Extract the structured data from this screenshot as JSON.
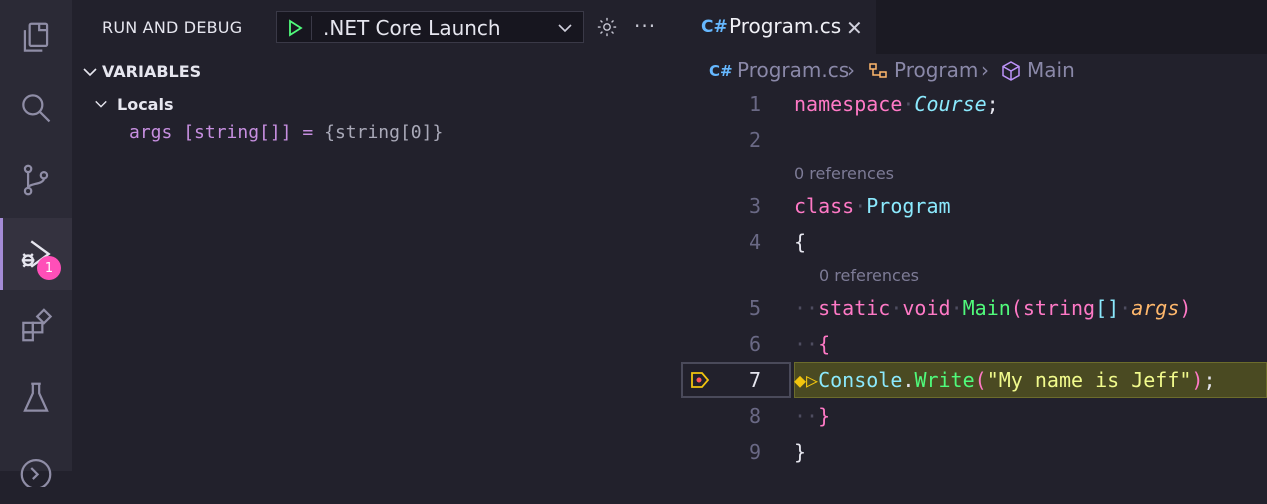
{
  "activity_bar": {
    "items": [
      {
        "name": "explorer"
      },
      {
        "name": "search"
      },
      {
        "name": "source-control"
      },
      {
        "name": "run-and-debug",
        "badge": "1"
      },
      {
        "name": "extensions"
      },
      {
        "name": "testing"
      },
      {
        "name": "remote"
      }
    ]
  },
  "side_panel": {
    "title": "RUN AND DEBUG",
    "launch_config": ".NET Core Launch",
    "more_label": "···",
    "variables_section": "VARIABLES",
    "locals_label": "Locals",
    "variable": {
      "name": "args",
      "type": "[string[]]",
      "eq": "=",
      "value": "{string[0]}"
    }
  },
  "editor": {
    "tab": {
      "icon_label": "C#",
      "name": "Program.cs",
      "close": "✕"
    },
    "breadcrumb": [
      "Program.cs",
      "Program",
      "Main"
    ],
    "references_label": "0 references",
    "line_numbers": [
      "1",
      "2",
      "3",
      "4",
      "5",
      "6",
      "7",
      "8",
      "9"
    ],
    "code": {
      "l1_kw": "namespace",
      "l1_ns": "Course",
      "l3_kw": "class",
      "l3_ty": "Program",
      "l4": "{",
      "l5_static": "static",
      "l5_void": "void",
      "l5_fn": "Main",
      "l5_type": "string",
      "l5_param": "args",
      "l6": "{",
      "l7_obj": "Console",
      "l7_fn": "Write",
      "l7_str": "\"My name is Jeff\"",
      "l8": "}",
      "l9": "}"
    }
  },
  "colors": {
    "accent": "#a48bd6",
    "badge": "#ff4fb8",
    "keyword": "#ff79c6",
    "type": "#8be9fd",
    "function": "#50fa7b",
    "string": "#f1fa8c"
  }
}
